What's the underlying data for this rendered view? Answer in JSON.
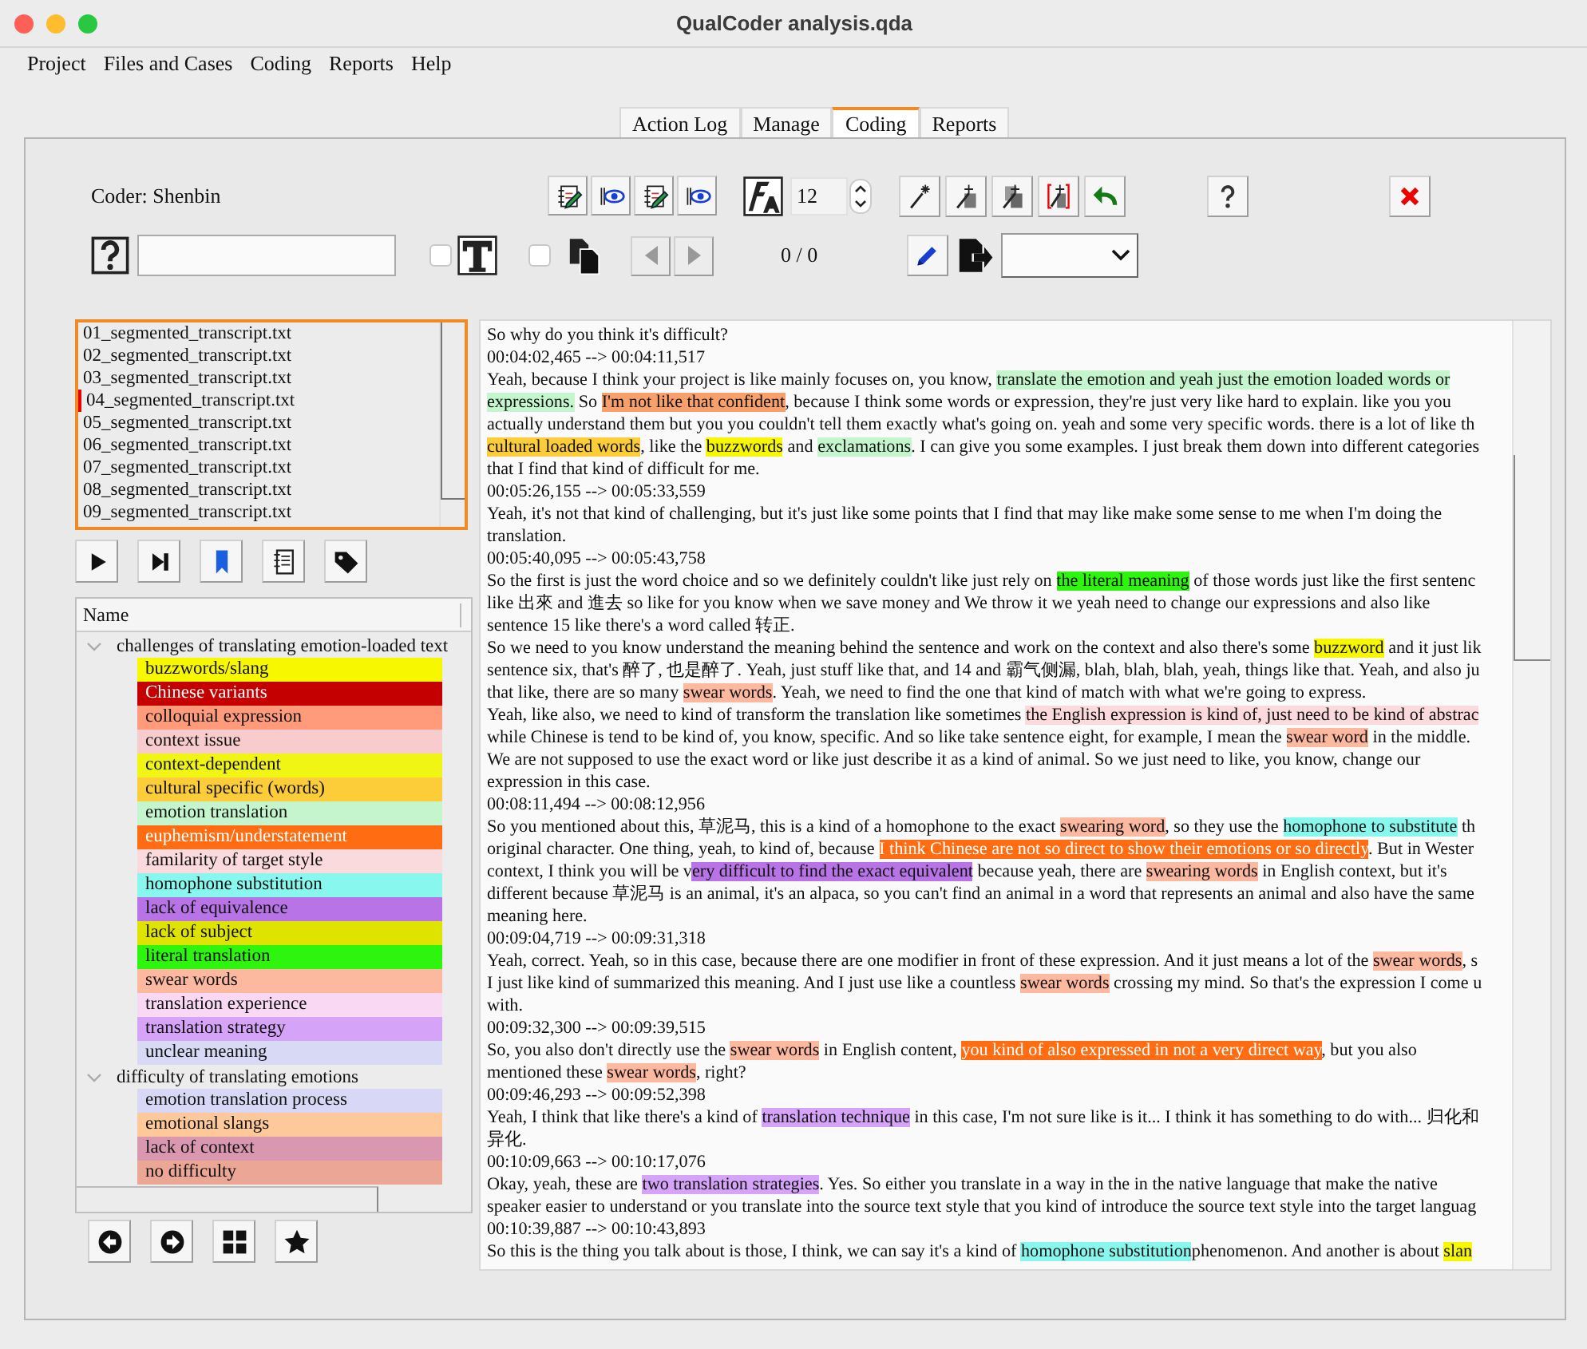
{
  "window": {
    "title": "QualCoder analysis.qda"
  },
  "menu": [
    "Project",
    "Files and Cases",
    "Coding",
    "Reports",
    "Help"
  ],
  "tabs": [
    {
      "label": "Action Log",
      "selected": false
    },
    {
      "label": "Manage",
      "selected": false
    },
    {
      "label": "Coding",
      "selected": true
    },
    {
      "label": "Reports",
      "selected": false
    }
  ],
  "toolbar": {
    "coder": "Coder: Shenbin",
    "font_size": "12",
    "match_counter": "0 / 0",
    "checkboxes": [
      {
        "checked": false
      },
      {
        "checked": false
      }
    ]
  },
  "files": [
    {
      "name": "01_segmented_transcript.txt",
      "selected": false
    },
    {
      "name": "02_segmented_transcript.txt",
      "selected": false
    },
    {
      "name": "03_segmented_transcript.txt",
      "selected": false
    },
    {
      "name": "04_segmented_transcript.txt",
      "selected": true
    },
    {
      "name": "05_segmented_transcript.txt",
      "selected": false
    },
    {
      "name": "06_segmented_transcript.txt",
      "selected": false
    },
    {
      "name": "07_segmented_transcript.txt",
      "selected": false
    },
    {
      "name": "08_segmented_transcript.txt",
      "selected": false
    },
    {
      "name": "09_segmented_transcript.txt",
      "selected": false
    }
  ],
  "code_tree": {
    "columns": [
      "Name"
    ],
    "categories": [
      {
        "name": "challenges of translating emotion-loaded text",
        "expanded": true,
        "children": [
          {
            "name": "buzzwords/slang",
            "color": "#f7f700"
          },
          {
            "name": "Chinese variants",
            "color": "#c40000"
          },
          {
            "name": "colloquial expression",
            "color": "#ff9a7a"
          },
          {
            "name": "context issue",
            "color": "#f8cccc"
          },
          {
            "name": "context-dependent",
            "color": "#f0f514"
          },
          {
            "name": "cultural specific (words)",
            "color": "#fccd38"
          },
          {
            "name": "emotion translation",
            "color": "#c4f5cc"
          },
          {
            "name": "euphemism/understatement",
            "color": "#ff6c11"
          },
          {
            "name": "familarity of target style",
            "color": "#fadadc"
          },
          {
            "name": "homophone substitution",
            "color": "#88f7ee"
          },
          {
            "name": "lack of equivalence",
            "color": "#b874e6"
          },
          {
            "name": "lack of subject",
            "color": "#dee300"
          },
          {
            "name": "literal translation",
            "color": "#2df50e"
          },
          {
            "name": "swear words",
            "color": "#fdb8a0"
          },
          {
            "name": "translation experience",
            "color": "#f9d8f4"
          },
          {
            "name": "translation strategy",
            "color": "#d5a4f8"
          },
          {
            "name": "unclear meaning",
            "color": "#d8daf5"
          }
        ]
      },
      {
        "name": "difficulty of translating emotions",
        "expanded": true,
        "children": [
          {
            "name": "emotion translation process",
            "color": "#d8d8f6"
          },
          {
            "name": "emotional slangs",
            "color": "#fdc99a"
          },
          {
            "name": "lack of context",
            "color": "#d998b0"
          },
          {
            "name": "no difficulty",
            "color": "#eba696"
          }
        ]
      }
    ]
  },
  "transcript": {
    "lines": [
      {
        "spans": [
          {
            "text": "So why do you think it's difficult?"
          }
        ]
      },
      {
        "spans": [
          {
            "text": "00:04:02,465 --> 00:04:11,517"
          }
        ]
      },
      {
        "spans": [
          {
            "text": "Yeah, because I think your project is like mainly focuses on, you know, "
          },
          {
            "text": "translate the emotion and yeah just the emotion loaded words or",
            "color": "#c4f5cc"
          }
        ]
      },
      {
        "spans": [
          {
            "text": "expressions.",
            "color": "#c4f5cc"
          },
          {
            "text": " So "
          },
          {
            "text": "I'm not like that confident",
            "color": "#f7a06c"
          },
          {
            "text": ", because I think some words or expression, they're just very like hard to explain. like you you"
          }
        ]
      },
      {
        "spans": [
          {
            "text": "actually understand them but you you couldn't tell them exactly what's going on. yeah and some very specific words. there is a lot of like th"
          }
        ]
      },
      {
        "spans": [
          {
            "text": "cultural loaded words",
            "color": "#fccd38"
          },
          {
            "text": ", like the "
          },
          {
            "text": "buzzwords",
            "color": "#f7f700"
          },
          {
            "text": " and "
          },
          {
            "text": "exclamations",
            "color": "#c4f5cc"
          },
          {
            "text": ". I can give you some examples. I just break them down into different categories"
          }
        ]
      },
      {
        "spans": [
          {
            "text": "that I find that kind of difficult for me."
          }
        ]
      },
      {
        "spans": [
          {
            "text": "00:05:26,155 --> 00:05:33,559"
          }
        ]
      },
      {
        "spans": [
          {
            "text": "Yeah, it's not that kind of challenging, but it's just like some points that I find that may like make some sense to me when I'm doing the"
          }
        ]
      },
      {
        "spans": [
          {
            "text": "translation."
          }
        ]
      },
      {
        "spans": [
          {
            "text": "00:05:40,095 --> 00:05:43,758"
          }
        ]
      },
      {
        "spans": [
          {
            "text": "So the first is just the word choice and so we definitely couldn't like just rely on "
          },
          {
            "text": "the literal meaning",
            "color": "#2df50e"
          },
          {
            "text": " of those words just like the first sentenc"
          }
        ]
      },
      {
        "spans": [
          {
            "text": "like 出來 and 進去 so like for you know when we save money and We throw it we yeah need to change our expressions and also like"
          }
        ]
      },
      {
        "spans": [
          {
            "text": "sentence 15 like there's a word called 转正."
          }
        ]
      },
      {
        "spans": [
          {
            "text": "So we need to you know understand the meaning behind the sentence and work on the context and also there's some "
          },
          {
            "text": "buzzword",
            "color": "#f7f700"
          },
          {
            "text": " and it just lik"
          }
        ]
      },
      {
        "spans": [
          {
            "text": "sentence six, that's 醉了, 也是醉了. Yeah, just stuff like that, and 14 and 霸气侧漏, blah, blah, blah, yeah, things like that. Yeah, and also ju"
          }
        ]
      },
      {
        "spans": [
          {
            "text": "that like, there are so many "
          },
          {
            "text": "swear words",
            "color": "#fdb8a0"
          },
          {
            "text": ". Yeah, we need to find the one that kind of match with what we're going to express."
          }
        ]
      },
      {
        "spans": [
          {
            "text": "Yeah, like also, we need to kind of transform the translation like sometimes "
          },
          {
            "text": "the English expression is kind of, just need to be kind of abstrac",
            "color": "#fadadc"
          }
        ]
      },
      {
        "spans": [
          {
            "text": "while Chinese is tend to be kind of, you know, specific. And so like take sentence eight, for example, I mean the "
          },
          {
            "text": "swear word",
            "color": "#fdb8a0"
          },
          {
            "text": " in the middle."
          }
        ]
      },
      {
        "spans": [
          {
            "text": "We are not supposed to use the exact word or like just describe it as a kind of animal. So we just need to like, you know, change our"
          }
        ]
      },
      {
        "spans": [
          {
            "text": "expression in this case."
          }
        ]
      },
      {
        "spans": [
          {
            "text": "00:08:11,494 --> 00:08:12,956"
          }
        ]
      },
      {
        "spans": [
          {
            "text": "So you mentioned about this, 草泥马, this is a kind of a homophone to the exact "
          },
          {
            "text": "swearing word",
            "color": "#fdb8a0"
          },
          {
            "text": ", so they use the "
          },
          {
            "text": "homophone to substitute",
            "color": "#88f7ee"
          },
          {
            "text": " th"
          }
        ]
      },
      {
        "spans": [
          {
            "text": "original character. One thing, yeah, to kind of, because "
          },
          {
            "text": "I think Chinese are not so direct to show their emotions or so directly",
            "color": "#ff6c11"
          },
          {
            "text": ". But in Wester"
          }
        ]
      },
      {
        "spans": [
          {
            "text": "context, I think you will be v"
          },
          {
            "text": "ery difficult to find the exact equivalent",
            "color": "#b874e6"
          },
          {
            "text": " because yeah, there are "
          },
          {
            "text": "swearing words",
            "color": "#fdb8a0"
          },
          {
            "text": " in English context, but it's"
          }
        ]
      },
      {
        "spans": [
          {
            "text": "different because 草泥马 is an animal, it's an alpaca, so you can't find an animal in a word that represents an animal and also have the same"
          }
        ]
      },
      {
        "spans": [
          {
            "text": "meaning here."
          }
        ]
      },
      {
        "spans": [
          {
            "text": "00:09:04,719 --> 00:09:31,318"
          }
        ]
      },
      {
        "spans": [
          {
            "text": "Yeah, correct. Yeah, so in this case, because there are one modifier in front of these expression. And it just means a lot of the "
          },
          {
            "text": "swear words",
            "color": "#fdb8a0"
          },
          {
            "text": ", s"
          }
        ]
      },
      {
        "spans": [
          {
            "text": "I just like kind of summarized this meaning. And I just use like a countless "
          },
          {
            "text": "swear words",
            "color": "#fdb8a0"
          },
          {
            "text": " crossing my mind. So that's the expression I come u"
          }
        ]
      },
      {
        "spans": [
          {
            "text": "with."
          }
        ]
      },
      {
        "spans": [
          {
            "text": "00:09:32,300 --> 00:09:39,515"
          }
        ]
      },
      {
        "spans": [
          {
            "text": "So, you also don't directly use the "
          },
          {
            "text": "swear words",
            "color": "#fdb8a0"
          },
          {
            "text": " in English content, "
          },
          {
            "text": "you kind of also expressed in not a very direct way",
            "color": "#ff6c11"
          },
          {
            "text": ", but you also"
          }
        ]
      },
      {
        "spans": [
          {
            "text": "mentioned these "
          },
          {
            "text": "swear words",
            "color": "#fdb8a0"
          },
          {
            "text": ", right?"
          }
        ]
      },
      {
        "spans": [
          {
            "text": "00:09:46,293 --> 00:09:52,398"
          }
        ]
      },
      {
        "spans": [
          {
            "text": "Yeah, I think that like there's a kind of "
          },
          {
            "text": "translation technique",
            "color": "#d5a4f8"
          },
          {
            "text": " in this case, I'm not sure like is it... I think it has something to do with... 归化和"
          }
        ]
      },
      {
        "spans": [
          {
            "text": "异化."
          }
        ]
      },
      {
        "spans": [
          {
            "text": "00:10:09,663 --> 00:10:17,076"
          }
        ]
      },
      {
        "spans": [
          {
            "text": "Okay, yeah, these are "
          },
          {
            "text": "two translation strategies",
            "color": "#d5a4f8"
          },
          {
            "text": ". Yes. So either you translate in a way in the in the native language that make the native"
          }
        ]
      },
      {
        "spans": [
          {
            "text": "speaker easier to understand or you translate into the source text style that you kind of introduce the source text style into the target languag"
          }
        ]
      },
      {
        "spans": [
          {
            "text": "00:10:39,887 --> 00:10:43,893"
          }
        ]
      },
      {
        "spans": [
          {
            "text": "So this is the thing you talk about is those, I think, we can say it's a kind of "
          },
          {
            "text": "homophone substitution",
            "color": "#88f7ee"
          },
          {
            "text": "phenomenon. And another is about "
          },
          {
            "text": "slan",
            "color": "#f7f700"
          }
        ]
      }
    ]
  }
}
